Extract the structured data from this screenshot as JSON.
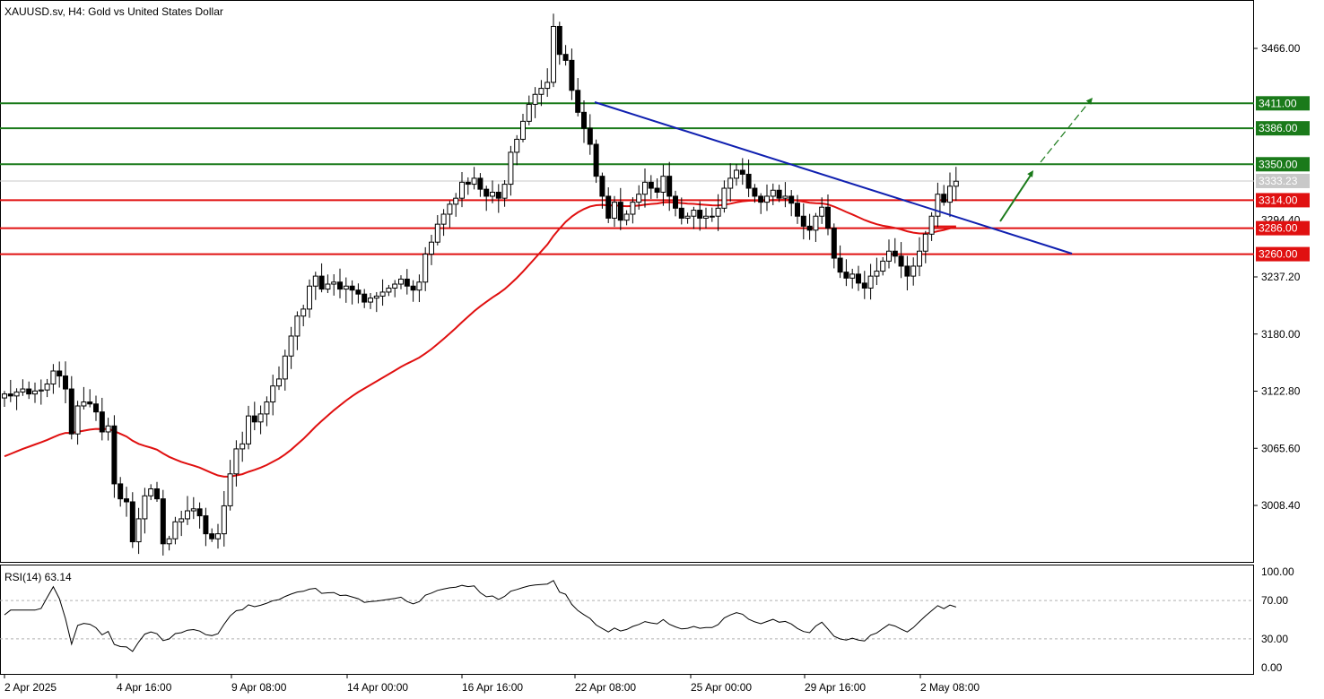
{
  "header": {
    "symbol_line": "XAUUSD.sv, H4:  Gold vs United States Dollar"
  },
  "rsi_header": {
    "label": "RSI(14) 63.14"
  },
  "chart_data": [
    {
      "type": "candlestick",
      "symbol": "XAUUSD.sv",
      "timeframe": "H4",
      "title": "Gold vs United States Dollar",
      "y_ticks": [
        "3466.00",
        "3237.20",
        "3180.00",
        "3122.80",
        "3065.60",
        "3008.40"
      ],
      "y_ticks_hidden_partial": [
        "3294.40"
      ],
      "ylim": [
        2950,
        3525
      ],
      "x_tick_labels": [
        "2 Apr 2025",
        "4 Apr 16:00",
        "9 Apr 08:00",
        "14 Apr 00:00",
        "16 Apr 16:00",
        "22 Apr 08:00",
        "25 Apr 00:00",
        "29 Apr 16:00",
        "2 May 08:00"
      ],
      "current_price": "3333.23",
      "resistance_levels": [
        {
          "label": "3411.00",
          "value": 3411.0,
          "color": "#1a7a1a"
        },
        {
          "label": "3386.00",
          "value": 3386.0,
          "color": "#1a7a1a"
        },
        {
          "label": "3350.00",
          "value": 3350.0,
          "color": "#1a7a1a"
        }
      ],
      "support_levels": [
        {
          "label": "3314.00",
          "value": 3314.0,
          "color": "#e01010"
        },
        {
          "label": "3286.00",
          "value": 3286.0,
          "color": "#e01010"
        },
        {
          "label": "3260.00",
          "value": 3260.0,
          "color": "#e01010"
        }
      ],
      "moving_average_color": "#e01010",
      "trendline_color": "#1020b0",
      "arrow_color": "#1a7a1a",
      "closes": [
        3120,
        3118,
        3122,
        3125,
        3120,
        3123,
        3124,
        3130,
        3143,
        3138,
        3125,
        3080,
        3108,
        3112,
        3110,
        3102,
        3082,
        3088,
        3030,
        3015,
        3012,
        2972,
        2995,
        3018,
        3025,
        3015,
        2970,
        2975,
        2992,
        2995,
        3003,
        3005,
        2998,
        2980,
        2975,
        2980,
        3008,
        3040,
        3065,
        3070,
        3098,
        3092,
        3100,
        3112,
        3128,
        3135,
        3158,
        3178,
        3198,
        3205,
        3228,
        3238,
        3225,
        3230,
        3232,
        3225,
        3228,
        3224,
        3220,
        3212,
        3216,
        3218,
        3222,
        3226,
        3230,
        3235,
        3228,
        3224,
        3232,
        3260,
        3272,
        3290,
        3300,
        3310,
        3316,
        3332,
        3330,
        3336,
        3325,
        3318,
        3322,
        3316,
        3330,
        3362,
        3375,
        3393,
        3410,
        3420,
        3426,
        3432,
        3488,
        3460,
        3454,
        3424,
        3402,
        3386,
        3370,
        3338,
        3318,
        3296,
        3312,
        3294,
        3300,
        3312,
        3320,
        3332,
        3326,
        3322,
        3338,
        3318,
        3306,
        3296,
        3298,
        3304,
        3296,
        3298,
        3298,
        3306,
        3326,
        3336,
        3344,
        3340,
        3326,
        3318,
        3312,
        3318,
        3324,
        3316,
        3318,
        3311,
        3298,
        3288,
        3284,
        3298,
        3307,
        3286,
        3256,
        3242,
        3236,
        3240,
        3231,
        3226,
        3238,
        3243,
        3253,
        3263,
        3258,
        3248,
        3238,
        3248,
        3263,
        3280,
        3298,
        3320,
        3312,
        3328,
        3333
      ]
    },
    {
      "type": "line",
      "name": "RSI(14)",
      "value": 63.14,
      "y_ticks": [
        "100.00",
        "70.00",
        "30.00",
        "0.00"
      ],
      "ylim": [
        0,
        100
      ],
      "dashed_levels": [
        70,
        30
      ]
    }
  ]
}
